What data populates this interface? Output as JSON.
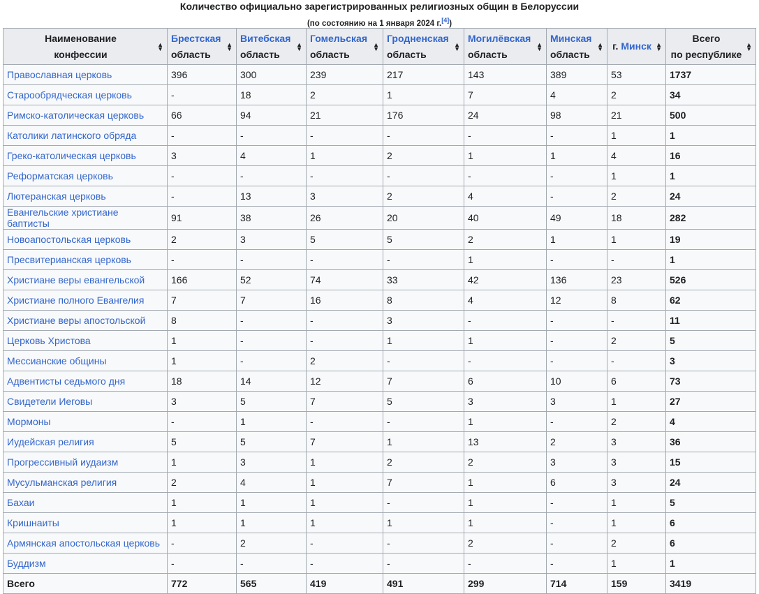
{
  "caption": "Количество официально зарегистрированных религиозных общин в Белоруссии",
  "subcaption": "(по состоянию на 1 января 2024 г.",
  "ref": "[4]",
  "subcaption_end": ")",
  "headers": [
    {
      "link": "",
      "line1": "Наименование",
      "line2": "конфессии"
    },
    {
      "link": "Брестская",
      "line2": "область"
    },
    {
      "link": "Витебская",
      "line2": "область"
    },
    {
      "link": "Гомельская",
      "line2": "область"
    },
    {
      "link": "Гродненская",
      "line2": "область"
    },
    {
      "link": "Могилёвская",
      "line2": "область"
    },
    {
      "link": "Минская",
      "line2": "область"
    },
    {
      "prefix": "г. ",
      "link": "Минск",
      "line2": ""
    },
    {
      "link": "",
      "line1": "Всего",
      "line2": "по республике"
    }
  ],
  "rows": [
    [
      "Православная церковь",
      "396",
      "300",
      "239",
      "217",
      "143",
      "389",
      "53",
      "1737"
    ],
    [
      "Старообрядческая церковь",
      "-",
      "18",
      "2",
      "1",
      "7",
      "4",
      "2",
      "34"
    ],
    [
      "Римско-католическая церковь",
      "66",
      "94",
      "21",
      "176",
      "24",
      "98",
      "21",
      "500"
    ],
    [
      "Католики латинского обряда",
      "-",
      "-",
      "-",
      "-",
      "-",
      "-",
      "1",
      "1"
    ],
    [
      "Греко-католическая церковь",
      "3",
      "4",
      "1",
      "2",
      "1",
      "1",
      "4",
      "16"
    ],
    [
      "Реформатская церковь",
      "-",
      "-",
      "-",
      "-",
      "-",
      "-",
      "1",
      "1"
    ],
    [
      "Лютеранская церковь",
      "-",
      "13",
      "3",
      "2",
      "4",
      "-",
      "2",
      "24"
    ],
    [
      "Евангельские христиане баптисты",
      "91",
      "38",
      "26",
      "20",
      "40",
      "49",
      "18",
      "282"
    ],
    [
      "Новоапостольская церковь",
      "2",
      "3",
      "5",
      "5",
      "2",
      "1",
      "1",
      "19"
    ],
    [
      "Пресвитерианская церковь",
      "-",
      "-",
      "-",
      "-",
      "1",
      "-",
      "-",
      "1"
    ],
    [
      "Христиане веры евангельской",
      "166",
      "52",
      "74",
      "33",
      "42",
      "136",
      "23",
      "526"
    ],
    [
      "Христиане полного Евангелия",
      "7",
      "7",
      "16",
      "8",
      "4",
      "12",
      "8",
      "62"
    ],
    [
      "Христиане веры апостольской",
      "8",
      "-",
      "-",
      "3",
      "-",
      "-",
      "-",
      "11"
    ],
    [
      "Церковь Христова",
      "1",
      "-",
      "-",
      "1",
      "1",
      "-",
      "2",
      "5"
    ],
    [
      "Мессианские общины",
      "1",
      "-",
      "2",
      "-",
      "-",
      "-",
      "-",
      "3"
    ],
    [
      "Адвентисты седьмого дня",
      "18",
      "14",
      "12",
      "7",
      "6",
      "10",
      "6",
      "73"
    ],
    [
      "Свидетели Иеговы",
      "3",
      "5",
      "7",
      "5",
      "3",
      "3",
      "1",
      "27"
    ],
    [
      "Мормоны",
      "-",
      "1",
      "-",
      "-",
      "1",
      "-",
      "2",
      "4"
    ],
    [
      "Иудейская религия",
      "5",
      "5",
      "7",
      "1",
      "13",
      "2",
      "3",
      "36"
    ],
    [
      "Прогрессивный иудаизм",
      "1",
      "3",
      "1",
      "2",
      "2",
      "3",
      "3",
      "15"
    ],
    [
      "Мусульманская религия",
      "2",
      "4",
      "1",
      "7",
      "1",
      "6",
      "3",
      "24"
    ],
    [
      "Бахаи",
      "1",
      "1",
      "1",
      "-",
      "1",
      "-",
      "1",
      "5"
    ],
    [
      "Кришнаиты",
      "1",
      "1",
      "1",
      "1",
      "1",
      "-",
      "1",
      "6"
    ],
    [
      "Армянская апостольская церковь",
      "-",
      "2",
      "-",
      "-",
      "2",
      "-",
      "2",
      "6"
    ],
    [
      "Буддизм",
      "-",
      "-",
      "-",
      "-",
      "-",
      "-",
      "1",
      "1"
    ]
  ],
  "total": [
    "Всего",
    "772",
    "565",
    "419",
    "491",
    "299",
    "714",
    "159",
    "3419"
  ]
}
